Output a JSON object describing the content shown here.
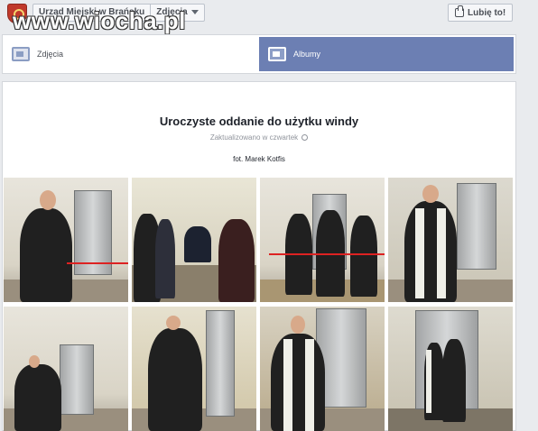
{
  "header": {
    "breadcrumb_page": "Urząd Miejski w Brańsku",
    "breadcrumb_section": "Zdjęcia",
    "like_label": "Lubię to!",
    "watermark": "www.wiocha.pl"
  },
  "tabs": [
    {
      "label": "Zdjęcia",
      "icon": "photo-icon",
      "active": false
    },
    {
      "label": "Albumy",
      "icon": "album-icon",
      "active": true
    }
  ],
  "album": {
    "title": "Uroczyste oddanie do użytku windy",
    "updated": "Zaktualizowano w czwartek",
    "description": "fot. Marek Kotfis"
  },
  "colors": {
    "accent": "#6c7fb3",
    "page_bg": "#e9ebee"
  }
}
